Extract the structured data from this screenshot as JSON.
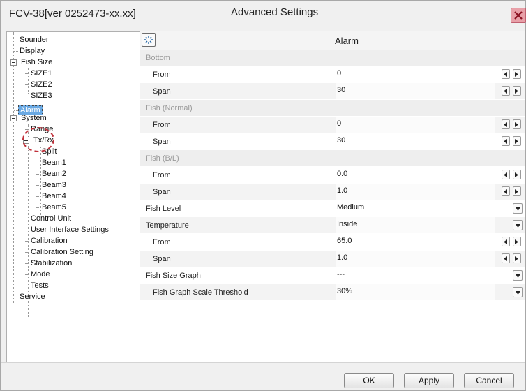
{
  "window": {
    "app_title": "FCV-38[ver 0252473-xx.xx]",
    "dialog_title": "Advanced Settings",
    "close_icon": "close-x-icon"
  },
  "tree": {
    "items": [
      {
        "label": "Sounder"
      },
      {
        "label": "Display"
      },
      {
        "label": "Fish Size",
        "expanded": true
      },
      {
        "label": "SIZE1"
      },
      {
        "label": "SIZE2"
      },
      {
        "label": "SIZE3"
      },
      {
        "label": "Alarm",
        "selected": true
      },
      {
        "label": "System",
        "expanded": true
      },
      {
        "label": "Range"
      },
      {
        "label": "Tx/Rx",
        "expanded": true
      },
      {
        "label": "Split"
      },
      {
        "label": "Beam1"
      },
      {
        "label": "Beam2"
      },
      {
        "label": "Beam3"
      },
      {
        "label": "Beam4"
      },
      {
        "label": "Beam5"
      },
      {
        "label": "Control Unit"
      },
      {
        "label": "User Interface Settings"
      },
      {
        "label": "Calibration"
      },
      {
        "label": "Calibration Setting"
      },
      {
        "label": "Stabilization"
      },
      {
        "label": "Mode"
      },
      {
        "label": "Tests"
      },
      {
        "label": "Service"
      }
    ]
  },
  "settings": {
    "title": "Alarm",
    "expand_icon": "expand-all-icon",
    "rows": [
      {
        "type": "section",
        "label": "Bottom"
      },
      {
        "type": "field",
        "label": "From",
        "value": "0",
        "control": "spin"
      },
      {
        "type": "field",
        "label": "Span",
        "value": "30",
        "control": "spin"
      },
      {
        "type": "section",
        "label": "Fish (Normal)"
      },
      {
        "type": "field",
        "label": "From",
        "value": "0",
        "control": "spin"
      },
      {
        "type": "field",
        "label": "Span",
        "value": "30",
        "control": "spin"
      },
      {
        "type": "section",
        "label": "Fish (B/L)"
      },
      {
        "type": "field",
        "label": "From",
        "value": "0.0",
        "control": "spin"
      },
      {
        "type": "field",
        "label": "Span",
        "value": "1.0",
        "control": "spin"
      },
      {
        "type": "top",
        "label": "Fish Level",
        "value": "Medium",
        "control": "dropdown"
      },
      {
        "type": "top",
        "label": "Temperature",
        "value": "Inside",
        "control": "dropdown"
      },
      {
        "type": "field",
        "label": "From",
        "value": "65.0",
        "control": "spin"
      },
      {
        "type": "field",
        "label": "Span",
        "value": "1.0",
        "control": "spin"
      },
      {
        "type": "top",
        "label": "Fish Size Graph",
        "value": "---",
        "control": "dropdown"
      },
      {
        "type": "field",
        "label": "Fish Graph Scale Threshold",
        "value": "30%",
        "control": "dropdown"
      }
    ]
  },
  "buttons": {
    "ok": "OK",
    "apply": "Apply",
    "cancel": "Cancel"
  },
  "colors": {
    "selection": "#6aa9e3",
    "highlight_ellipse": "#c0303a",
    "close_button": "#e8a0a8"
  }
}
